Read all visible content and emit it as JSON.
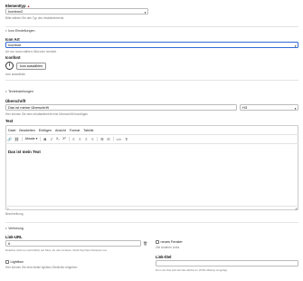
{
  "element_type": {
    "label": "Elementtyp",
    "value": "Iconbox2",
    "help": "Bitte wählen Sie den Typ des Inhaltselements."
  },
  "icon_settings": {
    "section_title": "Icon Einstellungen",
    "icon_art_label": "Icon Art",
    "icon_art_value": "Iconfont",
    "icon_art_help": "Art von Icons wählen: Bild oder Iconfont",
    "iconfont_label": "Iconfont",
    "iconfont_button": "Icon auswählen",
    "iconfont_help": "Icon auswählen"
  },
  "text_settings": {
    "section_title": "Texteinstellungen",
    "heading_label": "Überschrift",
    "heading_value": "Das ist meine Überschrift",
    "heading_level": "H3",
    "heading_help": "Hier können Sie dem Inhaltselement eine Überschrift hinzufügen.",
    "text_label": "Text",
    "menu": [
      "Datei",
      "Bearbeiten",
      "Einfügen",
      "Ansicht",
      "Format",
      "Tabelle"
    ],
    "format_select": "Absatz",
    "editor_content": "Das ist mein Text",
    "editor_status": "p",
    "text_help": "Beschreibung"
  },
  "link": {
    "section_title": "Verlinkung",
    "url_label": "Link-URL",
    "url_value": "#",
    "url_help": "Relativer (Ziel.net verbindlich) auf Sites, Zu oder anderen Inhalt Tag https://beispiel.com",
    "new_window_label": "neues Fenster",
    "new_window_help": "Ziel Anderen Links",
    "lightbox_label": "Lightbox",
    "lightbox_help": "Hier können Sie eine ideale lightbox-Störlicher eingeben",
    "title_label": "Link-titel",
    "title_help": "Der Link-Titel wird als title-Attribut im HTML-Markup eingefügt."
  }
}
